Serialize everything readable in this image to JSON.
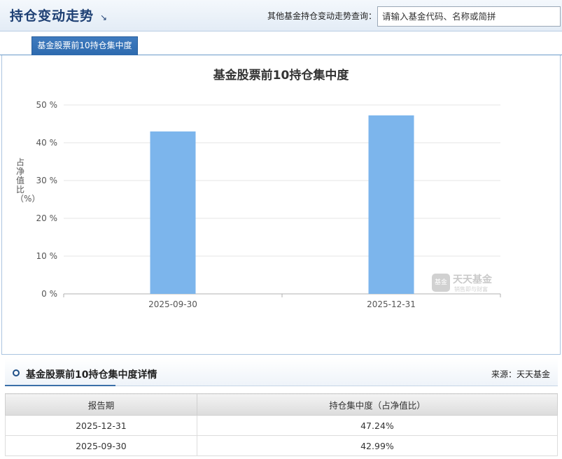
{
  "header": {
    "title": "持仓变动走势",
    "title_arrow": "↘",
    "search_label": "其他基金持仓变动走势查询：",
    "search_placeholder": "请输入基金代码、名称或简拼"
  },
  "tabs": [
    {
      "label": "基金股票前10持仓集中度",
      "active": true
    }
  ],
  "watermark": {
    "logo_text": "基金",
    "name": "天天基金",
    "slogan": "销售即与财富"
  },
  "chart_data": {
    "type": "bar",
    "title": "基金股票前10持仓集中度",
    "ylabel": "占净值比（%）",
    "xlabel": "",
    "categories": [
      "2025-09-30",
      "2025-12-31"
    ],
    "values": [
      42.99,
      47.24
    ],
    "ylim": [
      0,
      50
    ],
    "yticks": [
      0,
      10,
      20,
      30,
      40,
      50
    ],
    "ytick_labels": [
      "0 %",
      "10 %",
      "20 %",
      "30 %",
      "40 %",
      "50 %"
    ],
    "bar_color": "#7cb5ec",
    "grid": true,
    "legend": false
  },
  "details": {
    "title": "基金股票前10持仓集中度详情",
    "source": "来源：天天基金",
    "columns": [
      "报告期",
      "持仓集中度（占净值比）"
    ],
    "rows": [
      [
        "2025-12-31",
        "47.24%"
      ],
      [
        "2025-09-30",
        "42.99%"
      ]
    ]
  }
}
